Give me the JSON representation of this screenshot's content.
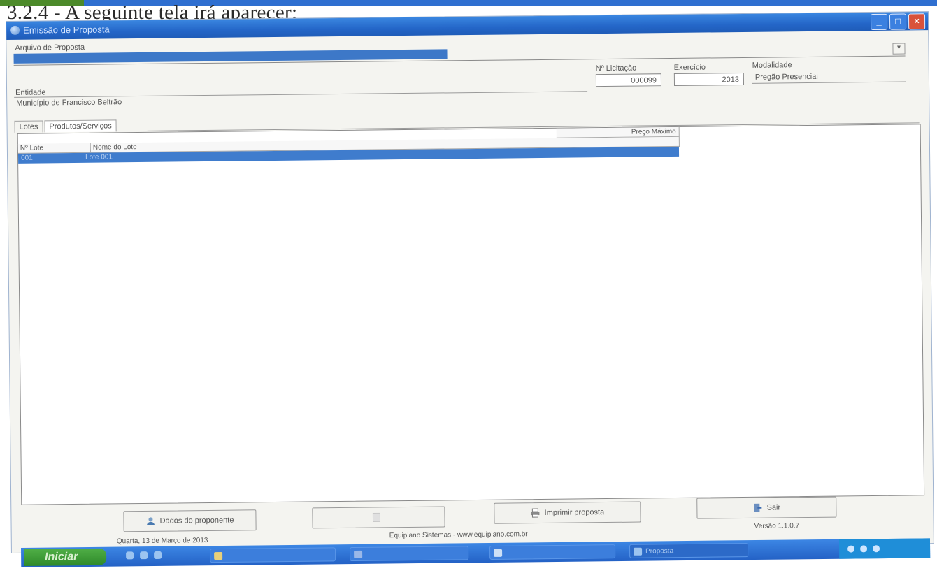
{
  "doc": {
    "heading": "3.2.4 - A seguinte tela irá aparecer:"
  },
  "window": {
    "title": "Emissão de Proposta",
    "controls": {
      "minimize": "_",
      "maximize": "□",
      "close": "×"
    }
  },
  "form": {
    "arquivo_label": "Arquivo de Proposta",
    "arquivo_value": "",
    "nr_licitacao_label": "Nº Licitação",
    "nr_licitacao_value": "000099",
    "exercicio_label": "Exercício",
    "exercicio_value": "2013",
    "modalidade_label": "Modalidade",
    "modalidade_value": "Pregão Presencial",
    "entidade_label": "Entidade",
    "entidade_value": "Município de Francisco Beltrão"
  },
  "tabs": [
    {
      "label": "Lotes"
    },
    {
      "label": "Produtos/Serviços"
    }
  ],
  "grid": {
    "columns": [
      "Nº Lote",
      "Nome do Lote",
      "Preço Máximo"
    ],
    "rows": [
      {
        "nr": "001",
        "nome": "Lote 001",
        "preco": ""
      }
    ]
  },
  "buttons": {
    "dados": "Dados do proponente",
    "gerar": "",
    "imprimir": "Imprimir proposta",
    "sair": "Sair"
  },
  "status": {
    "date": "Quarta, 13 de Março de 2013",
    "company": "Equiplano Sistemas - www.equiplano.com.br",
    "version": "Versão 1.1.0.7"
  },
  "taskbar": {
    "start": "Iniciar",
    "tasks": [
      "",
      "",
      "",
      "Proposta"
    ]
  }
}
